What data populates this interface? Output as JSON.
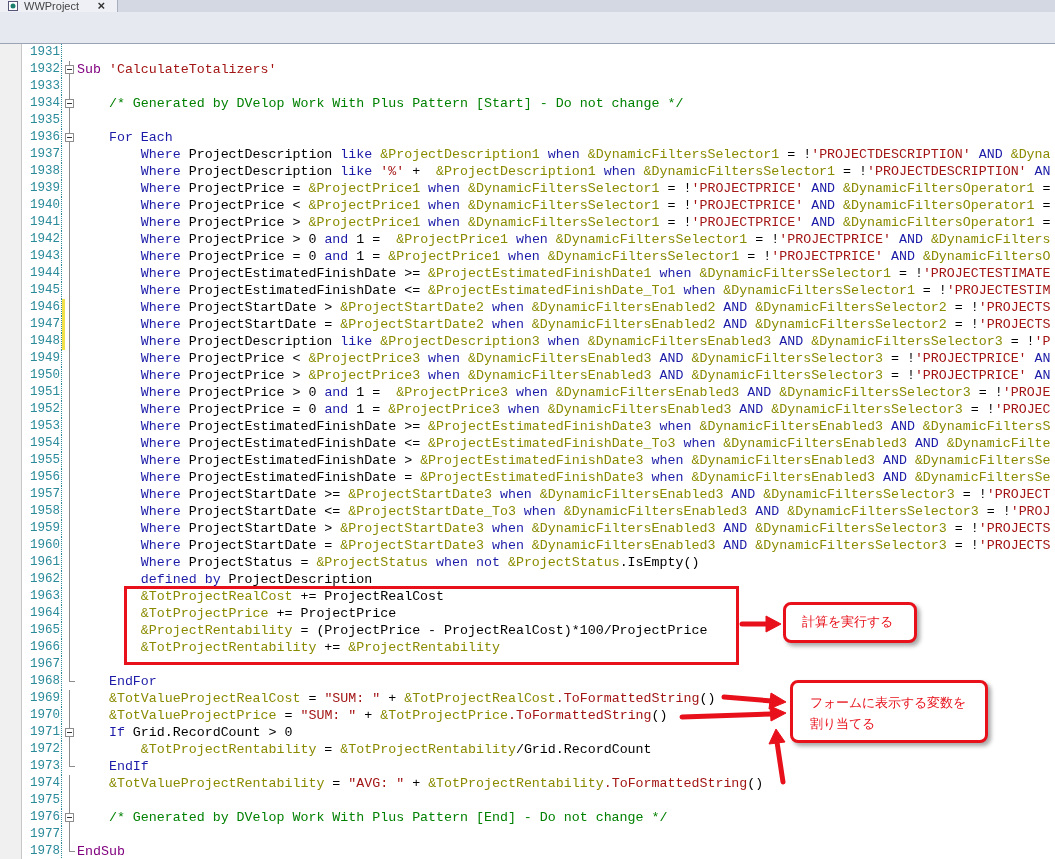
{
  "tab": {
    "title": "WWProject",
    "close": "×"
  },
  "editor": {
    "lines": [
      {
        "number": "1931",
        "kind": "code"
      },
      {
        "number": "1932",
        "kind": "block-start",
        "tokens": [
          {
            "kind": "decl",
            "text": "Sub"
          },
          {
            "kind": "s",
            "text": " 'CalculateTotalizers'"
          }
        ]
      },
      {
        "number": "1933",
        "kind": "code"
      },
      {
        "number": "1934",
        "kind": "block-start",
        "tokens": [
          {
            "kind": "c",
            "text": "    /* Generated by DVelop Work With Plus Pattern [Start] - Do not change */"
          }
        ]
      },
      {
        "number": "1935",
        "kind": "code"
      },
      {
        "number": "1936",
        "kind": "block-start",
        "tokens": [
          {
            "kind": "k",
            "text": "    For Each"
          }
        ]
      },
      {
        "number": "1937",
        "kind": "code",
        "tokens": [
          {
            "kind": "k",
            "text": "        Where"
          },
          {
            "kind": "p",
            "text": " ProjectDescription "
          },
          {
            "kind": "k",
            "text": "like"
          },
          {
            "kind": "v",
            "text": " &ProjectDescription1"
          },
          {
            "kind": "k",
            "text": " when"
          },
          {
            "kind": "v",
            "text": " &DynamicFiltersSelector1"
          },
          {
            "kind": "p",
            "text": " = !"
          },
          {
            "kind": "s",
            "text": "'PROJECTDESCRIPTION'"
          },
          {
            "kind": "k",
            "text": " AND"
          },
          {
            "kind": "v",
            "text": " &Dyna"
          }
        ]
      },
      {
        "number": "1938",
        "kind": "code",
        "tokens": [
          {
            "kind": "k",
            "text": "        Where"
          },
          {
            "kind": "p",
            "text": " ProjectDescription "
          },
          {
            "kind": "k",
            "text": "like"
          },
          {
            "kind": "s",
            "text": " '%'"
          },
          {
            "kind": "p",
            "text": " +  "
          },
          {
            "kind": "v",
            "text": "&ProjectDescription1"
          },
          {
            "kind": "k",
            "text": " when"
          },
          {
            "kind": "v",
            "text": " &DynamicFiltersSelector1"
          },
          {
            "kind": "p",
            "text": " = !"
          },
          {
            "kind": "s",
            "text": "'PROJECTDESCRIPTION'"
          },
          {
            "kind": "k",
            "text": " AN"
          }
        ]
      },
      {
        "number": "1939",
        "kind": "code",
        "tokens": [
          {
            "kind": "k",
            "text": "        Where"
          },
          {
            "kind": "p",
            "text": " ProjectPrice = "
          },
          {
            "kind": "v",
            "text": "&ProjectPrice1"
          },
          {
            "kind": "k",
            "text": " when"
          },
          {
            "kind": "v",
            "text": " &DynamicFiltersSelector1"
          },
          {
            "kind": "p",
            "text": " = !"
          },
          {
            "kind": "s",
            "text": "'PROJECTPRICE'"
          },
          {
            "kind": "k",
            "text": " AND"
          },
          {
            "kind": "v",
            "text": " &DynamicFiltersOperator1"
          },
          {
            "kind": "p",
            "text": " ="
          }
        ]
      },
      {
        "number": "1940",
        "kind": "code",
        "tokens": [
          {
            "kind": "k",
            "text": "        Where"
          },
          {
            "kind": "p",
            "text": " ProjectPrice < "
          },
          {
            "kind": "v",
            "text": "&ProjectPrice1"
          },
          {
            "kind": "k",
            "text": " when"
          },
          {
            "kind": "v",
            "text": " &DynamicFiltersSelector1"
          },
          {
            "kind": "p",
            "text": " = !"
          },
          {
            "kind": "s",
            "text": "'PROJECTPRICE'"
          },
          {
            "kind": "k",
            "text": " AND"
          },
          {
            "kind": "v",
            "text": " &DynamicFiltersOperator1"
          },
          {
            "kind": "p",
            "text": " ="
          }
        ]
      },
      {
        "number": "1941",
        "kind": "code",
        "tokens": [
          {
            "kind": "k",
            "text": "        Where"
          },
          {
            "kind": "p",
            "text": " ProjectPrice > "
          },
          {
            "kind": "v",
            "text": "&ProjectPrice1"
          },
          {
            "kind": "k",
            "text": " when"
          },
          {
            "kind": "v",
            "text": " &DynamicFiltersSelector1"
          },
          {
            "kind": "p",
            "text": " = !"
          },
          {
            "kind": "s",
            "text": "'PROJECTPRICE'"
          },
          {
            "kind": "k",
            "text": " AND"
          },
          {
            "kind": "v",
            "text": " &DynamicFiltersOperator1"
          },
          {
            "kind": "p",
            "text": " ="
          }
        ]
      },
      {
        "number": "1942",
        "kind": "code",
        "tokens": [
          {
            "kind": "k",
            "text": "        Where"
          },
          {
            "kind": "p",
            "text": " ProjectPrice > 0 "
          },
          {
            "kind": "k",
            "text": "and"
          },
          {
            "kind": "p",
            "text": " 1 =  "
          },
          {
            "kind": "v",
            "text": "&ProjectPrice1"
          },
          {
            "kind": "k",
            "text": " when"
          },
          {
            "kind": "v",
            "text": " &DynamicFiltersSelector1"
          },
          {
            "kind": "p",
            "text": " = !"
          },
          {
            "kind": "s",
            "text": "'PROJECTPRICE'"
          },
          {
            "kind": "k",
            "text": " AND"
          },
          {
            "kind": "v",
            "text": " &DynamicFilters"
          }
        ]
      },
      {
        "number": "1943",
        "kind": "code",
        "tokens": [
          {
            "kind": "k",
            "text": "        Where"
          },
          {
            "kind": "p",
            "text": " ProjectPrice = 0 "
          },
          {
            "kind": "k",
            "text": "and"
          },
          {
            "kind": "p",
            "text": " 1 = "
          },
          {
            "kind": "v",
            "text": "&ProjectPrice1"
          },
          {
            "kind": "k",
            "text": " when"
          },
          {
            "kind": "v",
            "text": " &DynamicFiltersSelector1"
          },
          {
            "kind": "p",
            "text": " = !"
          },
          {
            "kind": "s",
            "text": "'PROJECTPRICE'"
          },
          {
            "kind": "k",
            "text": " AND"
          },
          {
            "kind": "v",
            "text": " &DynamicFiltersO"
          }
        ]
      },
      {
        "number": "1944",
        "kind": "code",
        "tokens": [
          {
            "kind": "k",
            "text": "        Where"
          },
          {
            "kind": "p",
            "text": " ProjectEstimatedFinishDate >= "
          },
          {
            "kind": "v",
            "text": "&ProjectEstimatedFinishDate1"
          },
          {
            "kind": "k",
            "text": " when"
          },
          {
            "kind": "v",
            "text": " &DynamicFiltersSelector1"
          },
          {
            "kind": "p",
            "text": " = !"
          },
          {
            "kind": "s",
            "text": "'PROJECTESTIMATE"
          }
        ]
      },
      {
        "number": "1945",
        "kind": "code",
        "tokens": [
          {
            "kind": "k",
            "text": "        Where"
          },
          {
            "kind": "p",
            "text": " ProjectEstimatedFinishDate <= "
          },
          {
            "kind": "v",
            "text": "&ProjectEstimatedFinishDate_To1"
          },
          {
            "kind": "k",
            "text": " when"
          },
          {
            "kind": "v",
            "text": " &DynamicFiltersSelector1"
          },
          {
            "kind": "p",
            "text": " = !"
          },
          {
            "kind": "s",
            "text": "'PROJECTESTIM"
          }
        ]
      },
      {
        "number": "1946",
        "kind": "code",
        "modified": true,
        "tokens": [
          {
            "kind": "k",
            "text": "        Where"
          },
          {
            "kind": "p",
            "text": " ProjectStartDate > "
          },
          {
            "kind": "v",
            "text": "&ProjectStartDate2"
          },
          {
            "kind": "k",
            "text": " when"
          },
          {
            "kind": "v",
            "text": " &DynamicFiltersEnabled2"
          },
          {
            "kind": "k",
            "text": " AND"
          },
          {
            "kind": "v",
            "text": " &DynamicFiltersSelector2"
          },
          {
            "kind": "p",
            "text": " = !"
          },
          {
            "kind": "s",
            "text": "'PROJECTS"
          }
        ]
      },
      {
        "number": "1947",
        "kind": "code",
        "modified": true,
        "tokens": [
          {
            "kind": "k",
            "text": "        Where"
          },
          {
            "kind": "p",
            "text": " ProjectStartDate = "
          },
          {
            "kind": "v",
            "text": "&ProjectStartDate2"
          },
          {
            "kind": "k",
            "text": " when"
          },
          {
            "kind": "v",
            "text": " &DynamicFiltersEnabled2"
          },
          {
            "kind": "k",
            "text": " AND"
          },
          {
            "kind": "v",
            "text": " &DynamicFiltersSelector2"
          },
          {
            "kind": "p",
            "text": " = !"
          },
          {
            "kind": "s",
            "text": "'PROJECTS"
          }
        ]
      },
      {
        "number": "1948",
        "kind": "code",
        "modified": true,
        "tokens": [
          {
            "kind": "k",
            "text": "        Where"
          },
          {
            "kind": "p",
            "text": " ProjectDescription "
          },
          {
            "kind": "k",
            "text": "like"
          },
          {
            "kind": "v",
            "text": " &ProjectDescription3"
          },
          {
            "kind": "k",
            "text": " when"
          },
          {
            "kind": "v",
            "text": " &DynamicFiltersEnabled3"
          },
          {
            "kind": "k",
            "text": " AND"
          },
          {
            "kind": "v",
            "text": " &DynamicFiltersSelector3"
          },
          {
            "kind": "p",
            "text": " = !"
          },
          {
            "kind": "s",
            "text": "'P"
          }
        ]
      },
      {
        "number": "1949",
        "kind": "code",
        "tokens": [
          {
            "kind": "k",
            "text": "        Where"
          },
          {
            "kind": "p",
            "text": " ProjectPrice < "
          },
          {
            "kind": "v",
            "text": "&ProjectPrice3"
          },
          {
            "kind": "k",
            "text": " when"
          },
          {
            "kind": "v",
            "text": " &DynamicFiltersEnabled3"
          },
          {
            "kind": "k",
            "text": " AND"
          },
          {
            "kind": "v",
            "text": " &DynamicFiltersSelector3"
          },
          {
            "kind": "p",
            "text": " = !"
          },
          {
            "kind": "s",
            "text": "'PROJECTPRICE'"
          },
          {
            "kind": "k",
            "text": " AN"
          }
        ]
      },
      {
        "number": "1950",
        "kind": "code",
        "tokens": [
          {
            "kind": "k",
            "text": "        Where"
          },
          {
            "kind": "p",
            "text": " ProjectPrice > "
          },
          {
            "kind": "v",
            "text": "&ProjectPrice3"
          },
          {
            "kind": "k",
            "text": " when"
          },
          {
            "kind": "v",
            "text": " &DynamicFiltersEnabled3"
          },
          {
            "kind": "k",
            "text": " AND"
          },
          {
            "kind": "v",
            "text": " &DynamicFiltersSelector3"
          },
          {
            "kind": "p",
            "text": " = !"
          },
          {
            "kind": "s",
            "text": "'PROJECTPRICE'"
          },
          {
            "kind": "k",
            "text": " AN"
          }
        ]
      },
      {
        "number": "1951",
        "kind": "code",
        "tokens": [
          {
            "kind": "k",
            "text": "        Where"
          },
          {
            "kind": "p",
            "text": " ProjectPrice > 0 "
          },
          {
            "kind": "k",
            "text": "and"
          },
          {
            "kind": "p",
            "text": " 1 =  "
          },
          {
            "kind": "v",
            "text": "&ProjectPrice3"
          },
          {
            "kind": "k",
            "text": " when"
          },
          {
            "kind": "v",
            "text": " &DynamicFiltersEnabled3"
          },
          {
            "kind": "k",
            "text": " AND"
          },
          {
            "kind": "v",
            "text": " &DynamicFiltersSelector3"
          },
          {
            "kind": "p",
            "text": " = !"
          },
          {
            "kind": "s",
            "text": "'PROJE"
          }
        ]
      },
      {
        "number": "1952",
        "kind": "code",
        "tokens": [
          {
            "kind": "k",
            "text": "        Where"
          },
          {
            "kind": "p",
            "text": " ProjectPrice = 0 "
          },
          {
            "kind": "k",
            "text": "and"
          },
          {
            "kind": "p",
            "text": " 1 = "
          },
          {
            "kind": "v",
            "text": "&ProjectPrice3"
          },
          {
            "kind": "k",
            "text": " when"
          },
          {
            "kind": "v",
            "text": " &DynamicFiltersEnabled3"
          },
          {
            "kind": "k",
            "text": " AND"
          },
          {
            "kind": "v",
            "text": " &DynamicFiltersSelector3"
          },
          {
            "kind": "p",
            "text": " = !"
          },
          {
            "kind": "s",
            "text": "'PROJEC"
          }
        ]
      },
      {
        "number": "1953",
        "kind": "code",
        "tokens": [
          {
            "kind": "k",
            "text": "        Where"
          },
          {
            "kind": "p",
            "text": " ProjectEstimatedFinishDate >= "
          },
          {
            "kind": "v",
            "text": "&ProjectEstimatedFinishDate3"
          },
          {
            "kind": "k",
            "text": " when"
          },
          {
            "kind": "v",
            "text": " &DynamicFiltersEnabled3"
          },
          {
            "kind": "k",
            "text": " AND"
          },
          {
            "kind": "v",
            "text": " &DynamicFiltersS"
          }
        ]
      },
      {
        "number": "1954",
        "kind": "code",
        "tokens": [
          {
            "kind": "k",
            "text": "        Where"
          },
          {
            "kind": "p",
            "text": " ProjectEstimatedFinishDate <= "
          },
          {
            "kind": "v",
            "text": "&ProjectEstimatedFinishDate_To3"
          },
          {
            "kind": "k",
            "text": " when"
          },
          {
            "kind": "v",
            "text": " &DynamicFiltersEnabled3"
          },
          {
            "kind": "k",
            "text": " AND"
          },
          {
            "kind": "v",
            "text": " &DynamicFilte"
          }
        ]
      },
      {
        "number": "1955",
        "kind": "code",
        "tokens": [
          {
            "kind": "k",
            "text": "        Where"
          },
          {
            "kind": "p",
            "text": " ProjectEstimatedFinishDate > "
          },
          {
            "kind": "v",
            "text": "&ProjectEstimatedFinishDate3"
          },
          {
            "kind": "k",
            "text": " when"
          },
          {
            "kind": "v",
            "text": " &DynamicFiltersEnabled3"
          },
          {
            "kind": "k",
            "text": " AND"
          },
          {
            "kind": "v",
            "text": " &DynamicFiltersSe"
          }
        ]
      },
      {
        "number": "1956",
        "kind": "code",
        "tokens": [
          {
            "kind": "k",
            "text": "        Where"
          },
          {
            "kind": "p",
            "text": " ProjectEstimatedFinishDate = "
          },
          {
            "kind": "v",
            "text": "&ProjectEstimatedFinishDate3"
          },
          {
            "kind": "k",
            "text": " when"
          },
          {
            "kind": "v",
            "text": " &DynamicFiltersEnabled3"
          },
          {
            "kind": "k",
            "text": " AND"
          },
          {
            "kind": "v",
            "text": " &DynamicFiltersSe"
          }
        ]
      },
      {
        "number": "1957",
        "kind": "code",
        "tokens": [
          {
            "kind": "k",
            "text": "        Where"
          },
          {
            "kind": "p",
            "text": " ProjectStartDate >= "
          },
          {
            "kind": "v",
            "text": "&ProjectStartDate3"
          },
          {
            "kind": "k",
            "text": " when"
          },
          {
            "kind": "v",
            "text": " &DynamicFiltersEnabled3"
          },
          {
            "kind": "k",
            "text": " AND"
          },
          {
            "kind": "v",
            "text": " &DynamicFiltersSelector3"
          },
          {
            "kind": "p",
            "text": " = !"
          },
          {
            "kind": "s",
            "text": "'PROJECT"
          }
        ]
      },
      {
        "number": "1958",
        "kind": "code",
        "tokens": [
          {
            "kind": "k",
            "text": "        Where"
          },
          {
            "kind": "p",
            "text": " ProjectStartDate <= "
          },
          {
            "kind": "v",
            "text": "&ProjectStartDate_To3"
          },
          {
            "kind": "k",
            "text": " when"
          },
          {
            "kind": "v",
            "text": " &DynamicFiltersEnabled3"
          },
          {
            "kind": "k",
            "text": " AND"
          },
          {
            "kind": "v",
            "text": " &DynamicFiltersSelector3"
          },
          {
            "kind": "p",
            "text": " = !"
          },
          {
            "kind": "s",
            "text": "'PROJ"
          }
        ]
      },
      {
        "number": "1959",
        "kind": "code",
        "tokens": [
          {
            "kind": "k",
            "text": "        Where"
          },
          {
            "kind": "p",
            "text": " ProjectStartDate > "
          },
          {
            "kind": "v",
            "text": "&ProjectStartDate3"
          },
          {
            "kind": "k",
            "text": " when"
          },
          {
            "kind": "v",
            "text": " &DynamicFiltersEnabled3"
          },
          {
            "kind": "k",
            "text": " AND"
          },
          {
            "kind": "v",
            "text": " &DynamicFiltersSelector3"
          },
          {
            "kind": "p",
            "text": " = !"
          },
          {
            "kind": "s",
            "text": "'PROJECTS"
          }
        ]
      },
      {
        "number": "1960",
        "kind": "code",
        "tokens": [
          {
            "kind": "k",
            "text": "        Where"
          },
          {
            "kind": "p",
            "text": " ProjectStartDate = "
          },
          {
            "kind": "v",
            "text": "&ProjectStartDate3"
          },
          {
            "kind": "k",
            "text": " when"
          },
          {
            "kind": "v",
            "text": " &DynamicFiltersEnabled3"
          },
          {
            "kind": "k",
            "text": " AND"
          },
          {
            "kind": "v",
            "text": " &DynamicFiltersSelector3"
          },
          {
            "kind": "p",
            "text": " = !"
          },
          {
            "kind": "s",
            "text": "'PROJECTS"
          }
        ]
      },
      {
        "number": "1961",
        "kind": "code",
        "tokens": [
          {
            "kind": "k",
            "text": "        Where"
          },
          {
            "kind": "p",
            "text": " ProjectStatus = "
          },
          {
            "kind": "v",
            "text": "&ProjectStatus"
          },
          {
            "kind": "k",
            "text": " when not"
          },
          {
            "kind": "v",
            "text": " &ProjectStatus"
          },
          {
            "kind": "p",
            "text": ".IsEmpty()"
          }
        ]
      },
      {
        "number": "1962",
        "kind": "code",
        "tokens": [
          {
            "kind": "k",
            "text": "        defined by"
          },
          {
            "kind": "p",
            "text": " ProjectDescription"
          }
        ]
      },
      {
        "number": "1963",
        "kind": "code",
        "tokens": [
          {
            "kind": "v",
            "text": "        &TotProjectRealCost"
          },
          {
            "kind": "p",
            "text": " += ProjectRealCost"
          }
        ]
      },
      {
        "number": "1964",
        "kind": "code",
        "tokens": [
          {
            "kind": "v",
            "text": "        &TotProjectPrice"
          },
          {
            "kind": "p",
            "text": " += ProjectPrice"
          }
        ]
      },
      {
        "number": "1965",
        "kind": "code",
        "tokens": [
          {
            "kind": "v",
            "text": "        &ProjectRentability"
          },
          {
            "kind": "p",
            "text": " = (ProjectPrice - ProjectRealCost)*100/ProjectPrice"
          }
        ]
      },
      {
        "number": "1966",
        "kind": "code",
        "tokens": [
          {
            "kind": "v",
            "text": "        &TotProjectRentability"
          },
          {
            "kind": "p",
            "text": " += "
          },
          {
            "kind": "v",
            "text": "&ProjectRentability"
          }
        ]
      },
      {
        "number": "1967",
        "kind": "code"
      },
      {
        "number": "1968",
        "kind": "block-end",
        "tokens": [
          {
            "kind": "k",
            "text": "    EndFor"
          }
        ]
      },
      {
        "number": "1969",
        "kind": "code",
        "tokens": [
          {
            "kind": "v",
            "text": "    &TotValueProjectRealCost"
          },
          {
            "kind": "p",
            "text": " = "
          },
          {
            "kind": "s",
            "text": "\"SUM: \""
          },
          {
            "kind": "p",
            "text": " + "
          },
          {
            "kind": "v",
            "text": "&TotProjectRealCost"
          },
          {
            "kind": "m",
            "text": ".ToFormattedString"
          },
          {
            "kind": "p",
            "text": "()"
          }
        ]
      },
      {
        "number": "1970",
        "kind": "code",
        "tokens": [
          {
            "kind": "v",
            "text": "    &TotValueProjectPrice"
          },
          {
            "kind": "p",
            "text": " = "
          },
          {
            "kind": "s",
            "text": "\"SUM: \""
          },
          {
            "kind": "p",
            "text": " + "
          },
          {
            "kind": "v",
            "text": "&TotProjectPrice"
          },
          {
            "kind": "m",
            "text": ".ToFormattedString"
          },
          {
            "kind": "p",
            "text": "()"
          }
        ]
      },
      {
        "number": "1971",
        "kind": "block-start",
        "tokens": [
          {
            "kind": "k",
            "text": "    If"
          },
          {
            "kind": "p",
            "text": " Grid.RecordCount > 0"
          }
        ]
      },
      {
        "number": "1972",
        "kind": "code",
        "tokens": [
          {
            "kind": "v",
            "text": "        &TotProjectRentability"
          },
          {
            "kind": "p",
            "text": " = "
          },
          {
            "kind": "v",
            "text": "&TotProjectRentability"
          },
          {
            "kind": "p",
            "text": "/Grid.RecordCount"
          }
        ]
      },
      {
        "number": "1973",
        "kind": "block-end",
        "tokens": [
          {
            "kind": "k",
            "text": "    EndIf"
          }
        ]
      },
      {
        "number": "1974",
        "kind": "code",
        "tokens": [
          {
            "kind": "v",
            "text": "    &TotValueProjectRentability"
          },
          {
            "kind": "p",
            "text": " = "
          },
          {
            "kind": "s",
            "text": "\"AVG: \""
          },
          {
            "kind": "p",
            "text": " + "
          },
          {
            "kind": "v",
            "text": "&TotProjectRentability"
          },
          {
            "kind": "m",
            "text": ".ToFormattedString"
          },
          {
            "kind": "p",
            "text": "()"
          }
        ]
      },
      {
        "number": "1975",
        "kind": "code"
      },
      {
        "number": "1976",
        "kind": "block-start",
        "tokens": [
          {
            "kind": "c",
            "text": "    /* Generated by DVelop Work With Plus Pattern [End] - Do not change */"
          }
        ]
      },
      {
        "number": "1977",
        "kind": "code"
      },
      {
        "number": "1978",
        "kind": "block-end",
        "tokens": [
          {
            "kind": "decl",
            "text": "EndSub"
          }
        ]
      }
    ]
  },
  "callouts": [
    {
      "lines": [
        "計算を実行する"
      ]
    },
    {
      "lines": [
        "フォームに表示する変数を",
        "割り当てる"
      ]
    }
  ]
}
